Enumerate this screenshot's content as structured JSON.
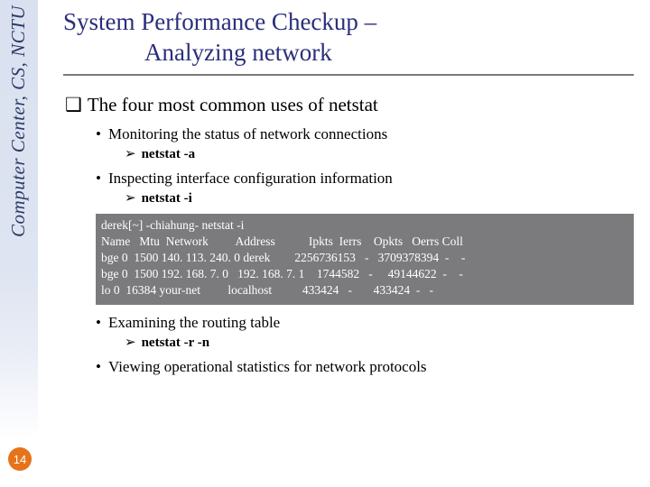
{
  "sidebar": {
    "org_text": "Computer Center, CS, NCTU"
  },
  "page_number": "14",
  "title": {
    "line1": "System Performance Checkup –",
    "line2": "Analyzing network"
  },
  "heading": {
    "marker": "❑",
    "text": "The four most common uses of netstat"
  },
  "bullets": {
    "b1": {
      "marker": "•",
      "text": "Monitoring the status of network connections",
      "cmd_marker": "➢",
      "cmd": "netstat -a"
    },
    "b2": {
      "marker": "•",
      "text": "Inspecting interface configuration information",
      "cmd_marker": "➢",
      "cmd": "netstat -i"
    },
    "b3": {
      "marker": "•",
      "text": "Examining the routing table",
      "cmd_marker": "➢",
      "cmd": "netstat -r -n"
    },
    "b4": {
      "marker": "•",
      "text": "Viewing operational statistics for network protocols"
    }
  },
  "terminal": {
    "text": "derek[~] -chiahung- netstat -i\nName   Mtu  Network         Address           Ipkts  Ierrs    Opkts   Oerrs Coll\nbge 0  1500 140. 113. 240. 0 derek        2256736153   -   3709378394  -    -\nbge 0  1500 192. 168. 7. 0   192. 168. 7. 1    1744582   -     49144622  -    -\nlo 0  16384 your-net         localhost          433424   -       433424  -   -"
  }
}
